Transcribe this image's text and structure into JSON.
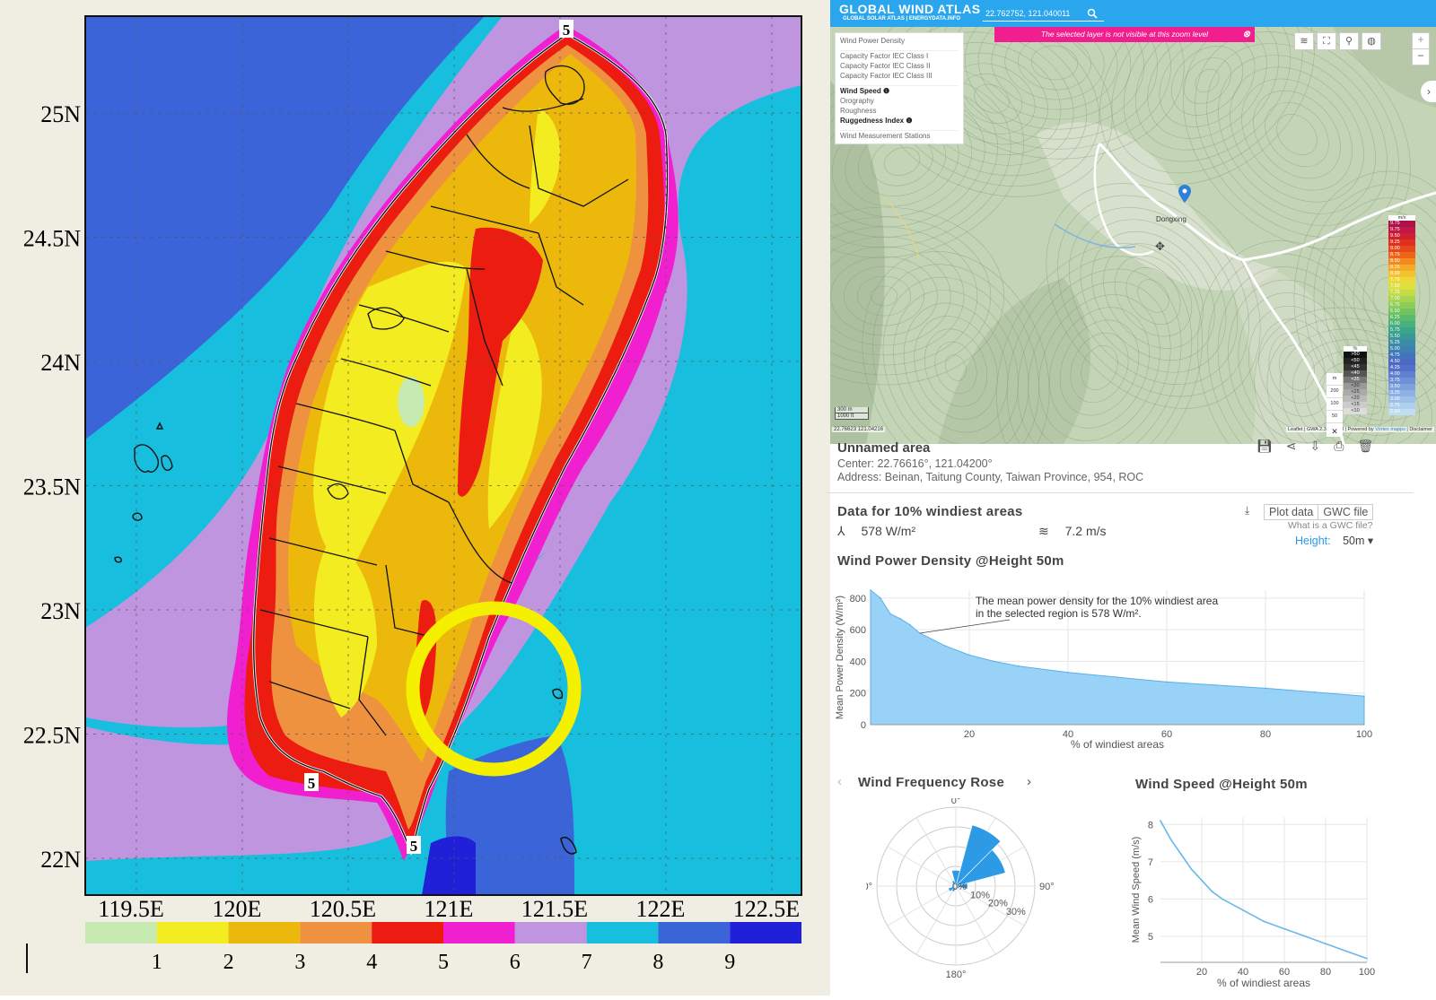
{
  "left_map": {
    "lat_labels": [
      {
        "text": "25N",
        "v": 25.0
      },
      {
        "text": "24.5N",
        "v": 24.5
      },
      {
        "text": "24N",
        "v": 24.0
      },
      {
        "text": "23.5N",
        "v": 23.5
      },
      {
        "text": "23N",
        "v": 23.0
      },
      {
        "text": "22.5N",
        "v": 22.5
      },
      {
        "text": "22N",
        "v": 22.0
      }
    ],
    "lon_labels": [
      "119.5E",
      "120E",
      "120.5E",
      "121E",
      "121.5E",
      "122E",
      "122.5E"
    ],
    "contour_labels": [
      "5",
      "5",
      "5"
    ],
    "colorbar": {
      "labels": [
        "1",
        "2",
        "3",
        "4",
        "5",
        "6",
        "7",
        "8",
        "9"
      ],
      "colors": [
        "#c6eab0",
        "#f2ec20",
        "#ecb80c",
        "#ef9240",
        "#ec1c10",
        "#f020d0",
        "#c095e0",
        "#18bede",
        "#3b64d8",
        "#2020d8"
      ]
    },
    "colors": {
      "land_yellow": "#f2ec20",
      "land_gold": "#ecb80c",
      "land_orange": "#ef9240",
      "red": "#ec1c10",
      "magenta": "#f020d0",
      "lavender": "#c095e0",
      "cyan": "#18bede",
      "blue": "#3b64d8",
      "deepblue": "#2020d8",
      "highlight_circle": "#f4f000"
    }
  },
  "gwa": {
    "logo_title": "GLOBAL WIND ATLAS",
    "logo_sub": "GLOBAL SOLAR ATLAS | ENERGYDATA.INFO",
    "search_value": "22.762752, 121.040011",
    "alert": "The selected layer is not visible at this zoom level",
    "layers": [
      "Wind Power Density",
      "Capacity Factor IEC Class I",
      "Capacity Factor IEC Class II",
      "Capacity Factor IEC Class III",
      "Wind Speed",
      "Orography",
      "Roughness",
      "Ruggedness Index",
      "Wind Measurement Stations"
    ],
    "place": "Dongxing",
    "scale": [
      "300 m",
      "1000 ft"
    ],
    "coords_footer": "22.76623 121.04216",
    "attribution": "Leaflet | GWA 2.3 © 2018 | Powered by ",
    "attribution_brand": "Vortex mapps",
    "attribution_tail": " | Disclaimer",
    "speed_legend_unit": "m/s",
    "speed_legend": [
      "9.75",
      "9.75",
      "9.50",
      "9.25",
      "9.00",
      "8.75",
      "8.50",
      "8.25",
      "8.00",
      "7.75",
      "7.50",
      "7.25",
      "7.00",
      "6.75",
      "6.50",
      "6.25",
      "6.00",
      "5.75",
      "5.50",
      "5.25",
      "5.00",
      "4.75",
      "4.50",
      "4.25",
      "4.00",
      "3.75",
      "3.50",
      "3.25",
      "3.00",
      "2.75",
      "2.50"
    ],
    "speed_legend_colors": [
      "#b01048",
      "#c01848",
      "#d02030",
      "#e03020",
      "#e84818",
      "#ee6418",
      "#f28a20",
      "#f6a828",
      "#f4c430",
      "#ecd838",
      "#dce040",
      "#c4dc48",
      "#a8d450",
      "#8ccc58",
      "#70c460",
      "#58ba6a",
      "#48b07a",
      "#3ca48a",
      "#389898",
      "#3a8ca6",
      "#3e80b2",
      "#4474bc",
      "#4a6ac4",
      "#5470ca",
      "#6080d0",
      "#6e90d6",
      "#7ea0dc",
      "#8eb0e2",
      "#9ec0e8",
      "#aed0ee",
      "#c0ddf2"
    ],
    "pct_legend_unit": "%",
    "pct_legend": [
      ">50",
      "<50",
      "<45",
      "<40",
      "<35",
      "<30",
      "<25",
      "<20",
      "<15",
      "<10"
    ],
    "pct_legend_heights": [
      "m",
      "200",
      "100",
      "50"
    ]
  },
  "area": {
    "title": "Unnamed area",
    "center": "Center: 22.76616°, 121.04200°",
    "address": "Address: Beinan, Taitung County, Taiwan Province, 954, ROC",
    "windiest_title": "Data for 10% windiest areas",
    "power": "578 W/m²",
    "speed": "7.2 m/s",
    "plot_data": "Plot data",
    "gwc_file": "GWC file",
    "gwc_question": "What is a GWC file?",
    "height_label": "Height:",
    "height_value": "50m ▾"
  },
  "wpd_chart": {
    "title": "Wind Power Density @Height 50m",
    "annotation_1": "The mean power density for the 10% windiest area",
    "annotation_2": "in the selected region is 578 W/m².",
    "chart_data": {
      "type": "area",
      "ylabel": "Mean Power Density (W/m²)",
      "xlabel": "% of windiest areas",
      "xlim": [
        0,
        100
      ],
      "ylim": [
        0,
        850
      ],
      "x_ticks": [
        "20",
        "40",
        "60",
        "80",
        "100"
      ],
      "y_ticks": [
        "0",
        "200",
        "400",
        "600",
        "800"
      ],
      "x": [
        0,
        2,
        4,
        6,
        8,
        10,
        15,
        20,
        25,
        30,
        40,
        50,
        60,
        70,
        80,
        90,
        100
      ],
      "y": [
        850,
        800,
        700,
        670,
        630,
        578,
        500,
        440,
        400,
        370,
        330,
        300,
        270,
        250,
        230,
        205,
        180
      ]
    }
  },
  "rose": {
    "title": "Wind Frequency Rose",
    "prev": "‹",
    "next": "›",
    "labels": [
      "0°",
      "90°",
      "180°",
      "270°"
    ],
    "ring_labels": [
      "0%",
      "10%",
      "20%",
      "30%"
    ],
    "chart_data": {
      "type": "bar",
      "categories": [
        "0°",
        "30°",
        "60°",
        "90°",
        "120°",
        "150°",
        "180°",
        "210°",
        "240°",
        "270°",
        "300°",
        "330°"
      ],
      "values": [
        8,
        32,
        26,
        6,
        2,
        1,
        2,
        3,
        4,
        2,
        2,
        3
      ]
    }
  },
  "ws_chart": {
    "title": "Wind Speed @Height 50m",
    "chart_data": {
      "type": "line",
      "ylabel": "Mean Wind Speed (m/s)",
      "xlabel": "% of windiest areas",
      "xlim": [
        0,
        100
      ],
      "ylim": [
        4.3,
        8.2
      ],
      "x_ticks": [
        "20",
        "40",
        "60",
        "80",
        "100"
      ],
      "y_ticks": [
        "5",
        "6",
        "7",
        "8"
      ],
      "x": [
        0,
        5,
        10,
        15,
        20,
        25,
        30,
        40,
        50,
        60,
        70,
        80,
        90,
        100
      ],
      "y": [
        8.1,
        7.6,
        7.2,
        6.8,
        6.5,
        6.2,
        6.0,
        5.7,
        5.4,
        5.2,
        5.0,
        4.8,
        4.6,
        4.4
      ]
    }
  }
}
